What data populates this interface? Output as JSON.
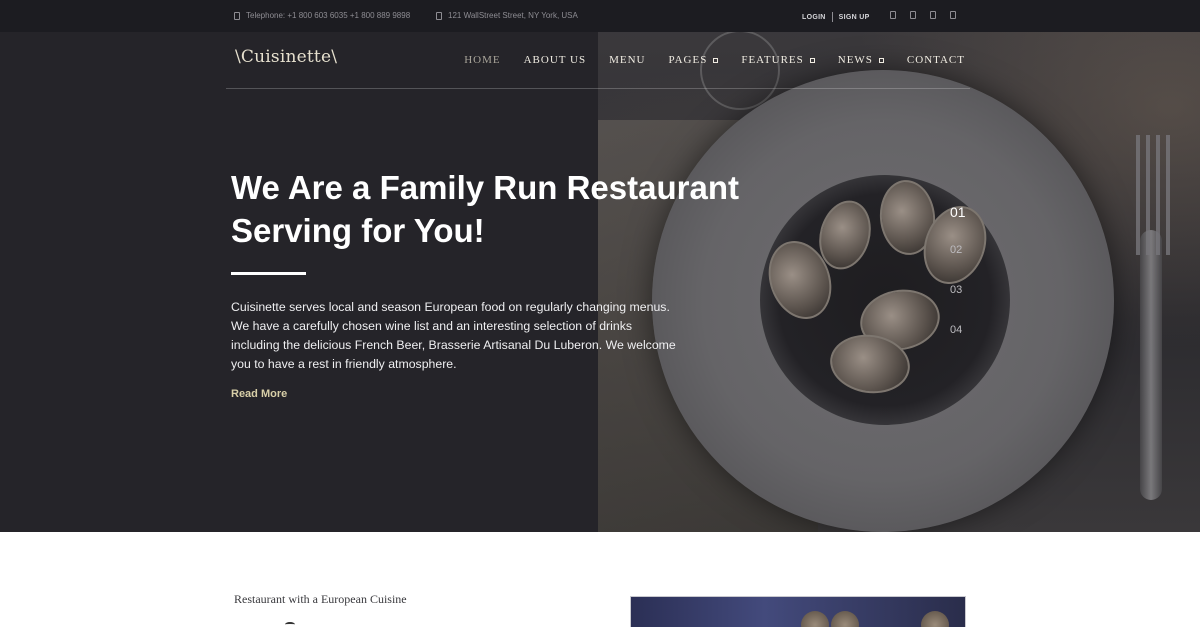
{
  "topbar": {
    "phone": "Telephone: +1 800 603 6035 +1 800 889 9898",
    "address": "121 WallStreet Street, NY York, USA",
    "login": "LOGIN",
    "signup": "SIGN UP",
    "social_icons": [
      "facebook-icon",
      "twitter-icon",
      "google-plus-icon",
      "instagram-icon"
    ]
  },
  "nav": {
    "logo": "\\Cuisinette\\",
    "items": [
      {
        "label": "HOME"
      },
      {
        "label": "ABOUT US"
      },
      {
        "label": "MENU"
      },
      {
        "label": "PAGES"
      },
      {
        "label": "FEATURES"
      },
      {
        "label": "NEWS"
      },
      {
        "label": "CONTACT"
      }
    ]
  },
  "hero": {
    "headline_line1": "We Are a Family Run Restaurant",
    "headline_line2": "Serving for You!",
    "description": "Cuisinette serves local and season European food on regularly changing menus. We have a carefully chosen wine list and an interesting selection of drinks including the delicious French Beer, Brasserie Artisanal Du Luberon. We welcome you to have a rest in friendly atmosphere.",
    "read_more": "Read More",
    "slides": [
      "01",
      "02",
      "03",
      "04"
    ],
    "active_slide": "01"
  },
  "section": {
    "subtitle": "Restaurant with a European Cuisine"
  },
  "colors": {
    "hero_bg": "#252429",
    "topbar_bg": "#1c1c21",
    "accent": "#d8cfa8"
  }
}
